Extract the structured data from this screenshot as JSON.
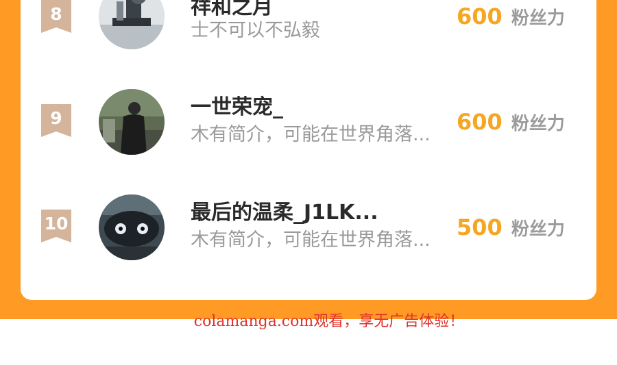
{
  "colors": {
    "page_background": "#FF9B24",
    "card_background": "#ffffff",
    "rank_badge": "#D4B49A",
    "fans_value": "#F5A623",
    "fans_unit": "#9b9b9b",
    "name_text": "#2a2a2a",
    "bio_text": "#9a9a9a",
    "watermark": "#e0312c"
  },
  "ranking": {
    "rows": [
      {
        "rank": "8",
        "name": "祥和之月",
        "bio": "士不可以不弘毅",
        "fans_value": "600",
        "fans_unit": "粉丝力",
        "avatar_icon": "microscope-photo-avatar"
      },
      {
        "rank": "9",
        "name": "一世荣宠_",
        "bio": "木有简介，可能在世界角落...",
        "fans_value": "600",
        "fans_unit": "粉丝力",
        "avatar_icon": "person-in-black-photo-avatar"
      },
      {
        "rank": "10",
        "name": "最后的温柔_J1LK...",
        "bio": "木有简介，可能在世界角落...",
        "fans_value": "500",
        "fans_unit": "粉丝力",
        "avatar_icon": "dark-creature-photo-avatar"
      }
    ]
  },
  "watermark": "colamanga.com观看，享无广告体验！"
}
